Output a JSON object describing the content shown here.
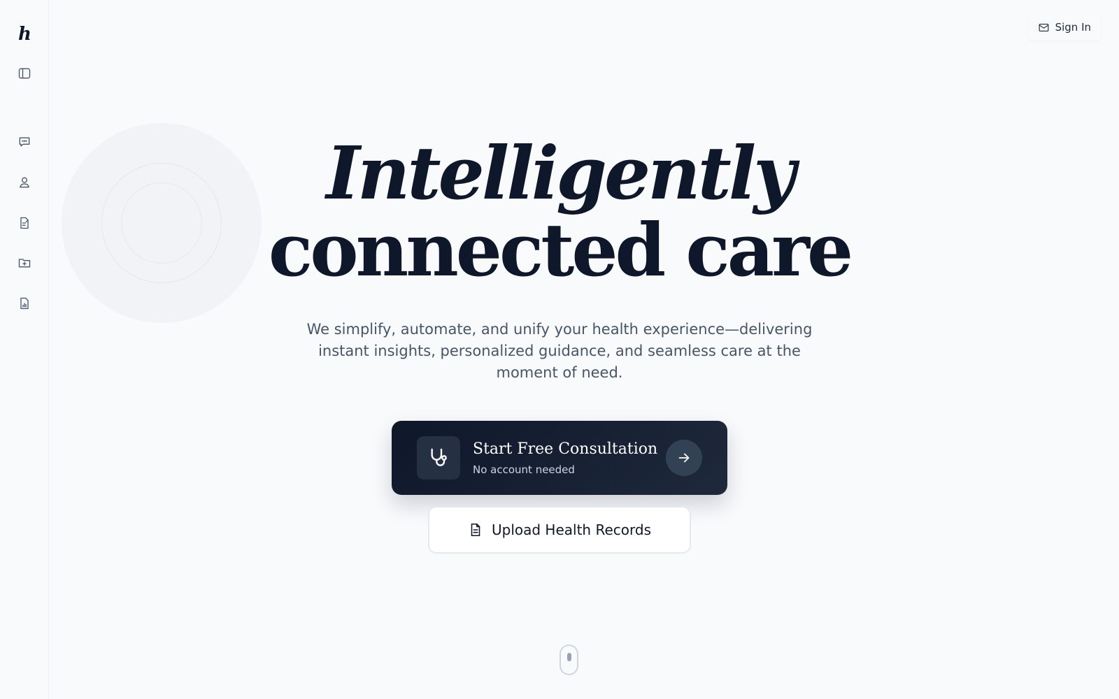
{
  "sidebar": {
    "logo": "h",
    "icons": [
      "sidebar-toggle-icon",
      "chat-icon",
      "user-icon",
      "document-edit-icon",
      "folder-plus-icon",
      "report-chart-icon"
    ]
  },
  "header": {
    "sign_in_label": "Sign In",
    "sign_in_icon": "mail-icon"
  },
  "hero": {
    "title_line1": "Intelligently",
    "title_line2": "connected care",
    "subtitle": "We simplify, automate, and unify your health experience—delivering instant insights, personalized guidance, and seamless care at the moment of need."
  },
  "cta": {
    "title": "Start Free Consultation",
    "subtitle": "No account needed",
    "icon": "stethoscope-icon",
    "arrow_icon": "arrow-right-icon"
  },
  "upload": {
    "label": "Upload Health Records",
    "icon": "document-icon"
  },
  "colors": {
    "background": "#f8fafc",
    "primary": "#0f172a",
    "muted_text": "#475569"
  }
}
